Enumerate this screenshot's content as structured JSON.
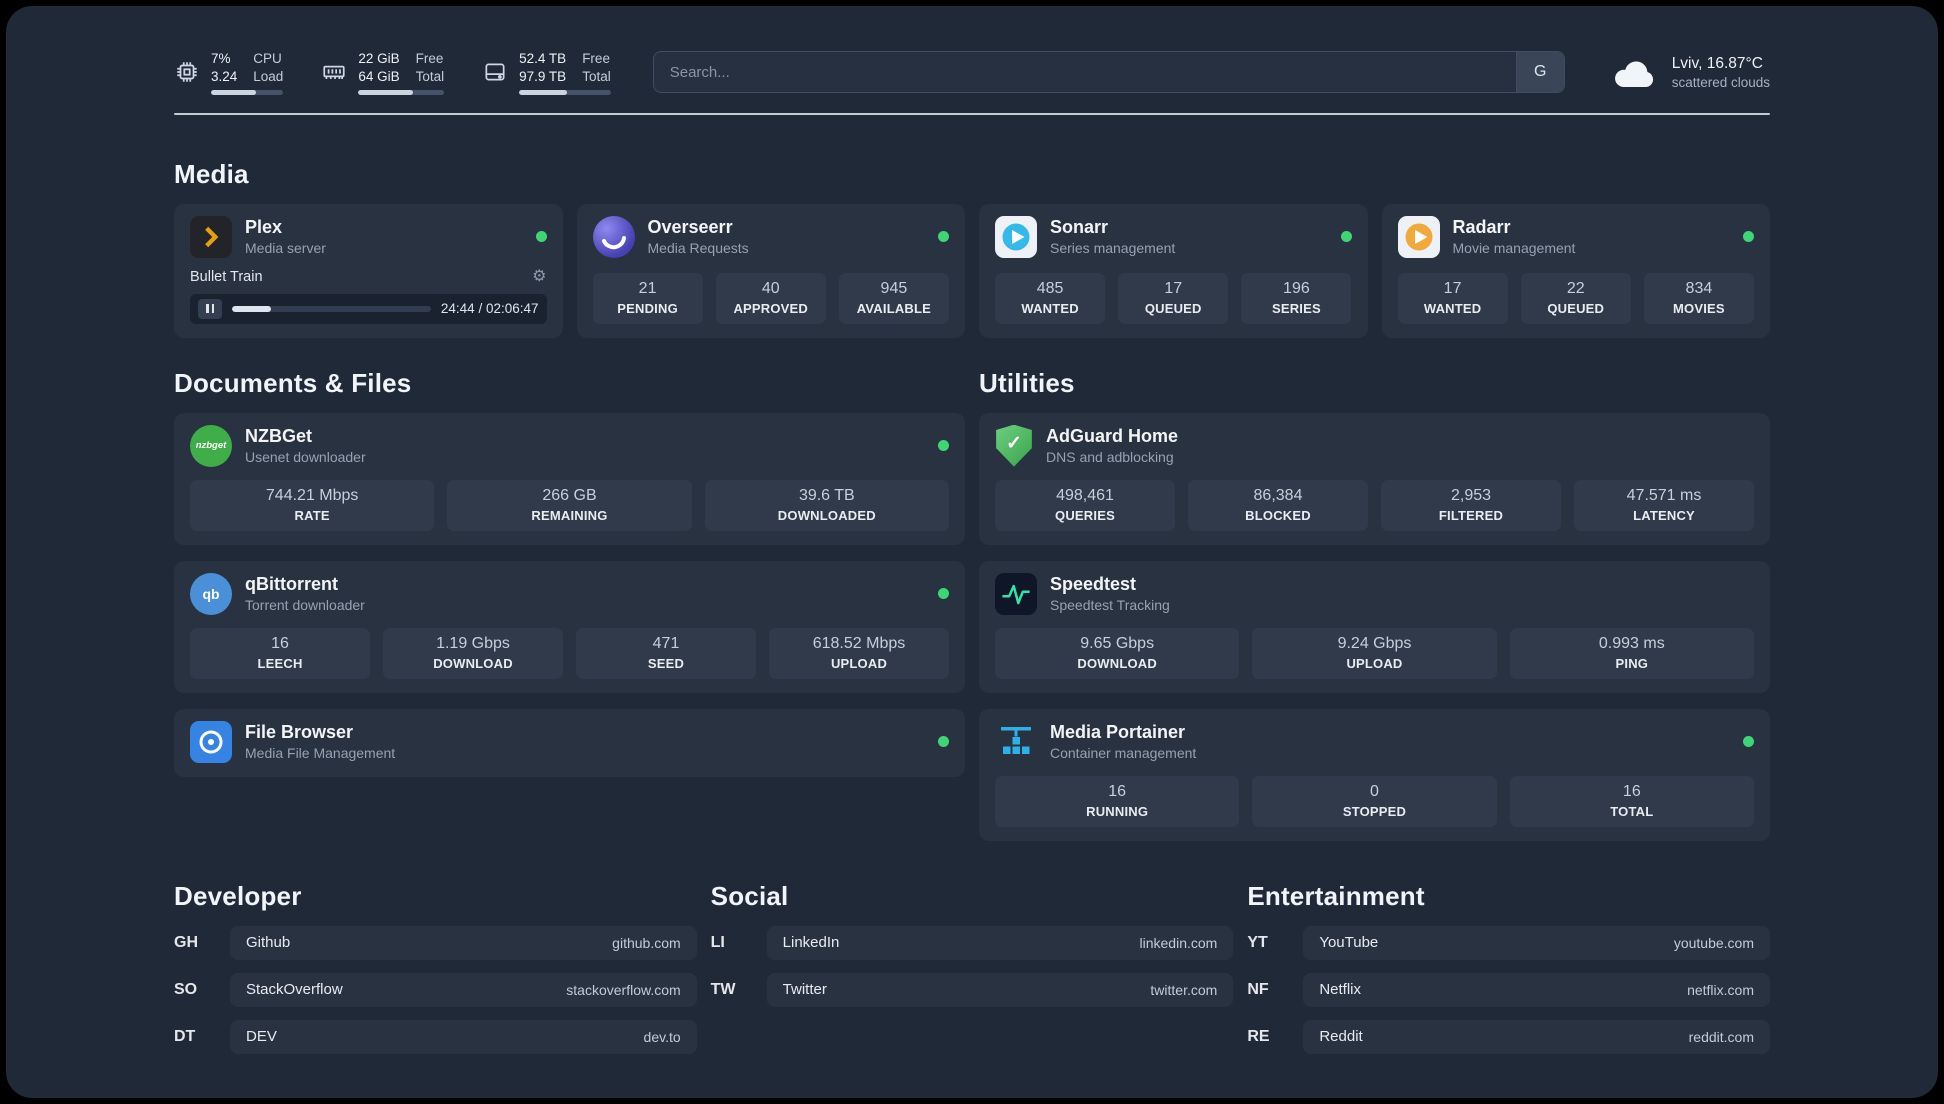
{
  "colors": {
    "background": "#202938",
    "card": "#293240",
    "stat_box": "#303a4a",
    "status_online": "#3ed675",
    "plex_amber": "#e5a00d",
    "overseerr_purple": "#4740b4",
    "sonarr_blue": "#35b8ea",
    "radarr_amber": "#f2a93b",
    "nzbget_green": "#3fae49",
    "qbittorrent_blue": "#4a90d9",
    "filebrowser_blue": "#3584e4",
    "adguard_green": "#37a34a",
    "speedtest_green": "#2ee6a8",
    "portainer_blue": "#2fb1e8"
  },
  "icons": {
    "gear_glyph": "⚙",
    "check_glyph": "✓"
  },
  "header": {
    "cpu": {
      "value_top": "7%",
      "value_bottom": "3.24",
      "label_top": "CPU",
      "label_bottom": "Load",
      "bar_percent": 62
    },
    "ram": {
      "value_top": "22 GiB",
      "value_bottom": "64 GiB",
      "label_top": "Free",
      "label_bottom": "Total",
      "bar_percent": 64
    },
    "disk": {
      "value_top": "52.4 TB",
      "value_bottom": "97.9 TB",
      "label_top": "Free",
      "label_bottom": "Total",
      "bar_percent": 52
    },
    "search": {
      "placeholder": "Search...",
      "button_label": "G"
    },
    "weather": {
      "location": "Lviv, 16.87°C",
      "condition": "scattered clouds"
    }
  },
  "sections": {
    "media": {
      "title": "Media",
      "plex": {
        "name": "Plex",
        "subtitle": "Media server",
        "now_playing": "Bullet Train",
        "elapsed": "24:44 / 02:06:47",
        "progress_percent": 19.5
      },
      "overseerr": {
        "name": "Overseerr",
        "subtitle": "Media Requests",
        "stats": [
          {
            "value": "21",
            "label": "PENDING"
          },
          {
            "value": "40",
            "label": "APPROVED"
          },
          {
            "value": "945",
            "label": "AVAILABLE"
          }
        ]
      },
      "sonarr": {
        "name": "Sonarr",
        "subtitle": "Series management",
        "stats": [
          {
            "value": "485",
            "label": "WANTED"
          },
          {
            "value": "17",
            "label": "QUEUED"
          },
          {
            "value": "196",
            "label": "SERIES"
          }
        ]
      },
      "radarr": {
        "name": "Radarr",
        "subtitle": "Movie management",
        "stats": [
          {
            "value": "17",
            "label": "WANTED"
          },
          {
            "value": "22",
            "label": "QUEUED"
          },
          {
            "value": "834",
            "label": "MOVIES"
          }
        ]
      }
    },
    "documents": {
      "title": "Documents & Files",
      "nzbget": {
        "name": "NZBGet",
        "subtitle": "Usenet downloader",
        "icon_text": "nzbget",
        "stats": [
          {
            "value": "744.21 Mbps",
            "label": "RATE"
          },
          {
            "value": "266 GB",
            "label": "REMAINING"
          },
          {
            "value": "39.6 TB",
            "label": "DOWNLOADED"
          }
        ]
      },
      "qbittorrent": {
        "name": "qBittorrent",
        "subtitle": "Torrent downloader",
        "icon_text": "qb",
        "stats": [
          {
            "value": "16",
            "label": "LEECH"
          },
          {
            "value": "1.19 Gbps",
            "label": "DOWNLOAD"
          },
          {
            "value": "471",
            "label": "SEED"
          },
          {
            "value": "618.52 Mbps",
            "label": "UPLOAD"
          }
        ]
      },
      "filebrowser": {
        "name": "File Browser",
        "subtitle": "Media File Management"
      }
    },
    "utilities": {
      "title": "Utilities",
      "adguard": {
        "name": "AdGuard Home",
        "subtitle": "DNS and adblocking",
        "stats": [
          {
            "value": "498,461",
            "label": "QUERIES"
          },
          {
            "value": "86,384",
            "label": "BLOCKED"
          },
          {
            "value": "2,953",
            "label": "FILTERED"
          },
          {
            "value": "47.571 ms",
            "label": "LATENCY"
          }
        ]
      },
      "speedtest": {
        "name": "Speedtest",
        "subtitle": "Speedtest Tracking",
        "stats": [
          {
            "value": "9.65 Gbps",
            "label": "DOWNLOAD"
          },
          {
            "value": "9.24 Gbps",
            "label": "UPLOAD"
          },
          {
            "value": "0.993 ms",
            "label": "PING"
          }
        ]
      },
      "portainer": {
        "name": "Media Portainer",
        "subtitle": "Container management",
        "stats": [
          {
            "value": "16",
            "label": "RUNNING"
          },
          {
            "value": "0",
            "label": "STOPPED"
          },
          {
            "value": "16",
            "label": "TOTAL"
          }
        ]
      }
    }
  },
  "bookmarks": {
    "developer": {
      "title": "Developer",
      "items": [
        {
          "abbr": "GH",
          "name": "Github",
          "url": "github.com"
        },
        {
          "abbr": "SO",
          "name": "StackOverflow",
          "url": "stackoverflow.com"
        },
        {
          "abbr": "DT",
          "name": "DEV",
          "url": "dev.to"
        }
      ]
    },
    "social": {
      "title": "Social",
      "items": [
        {
          "abbr": "LI",
          "name": "LinkedIn",
          "url": "linkedin.com"
        },
        {
          "abbr": "TW",
          "name": "Twitter",
          "url": "twitter.com"
        }
      ]
    },
    "entertainment": {
      "title": "Entertainment",
      "items": [
        {
          "abbr": "YT",
          "name": "YouTube",
          "url": "youtube.com"
        },
        {
          "abbr": "NF",
          "name": "Netflix",
          "url": "netflix.com"
        },
        {
          "abbr": "RE",
          "name": "Reddit",
          "url": "reddit.com"
        }
      ]
    }
  }
}
